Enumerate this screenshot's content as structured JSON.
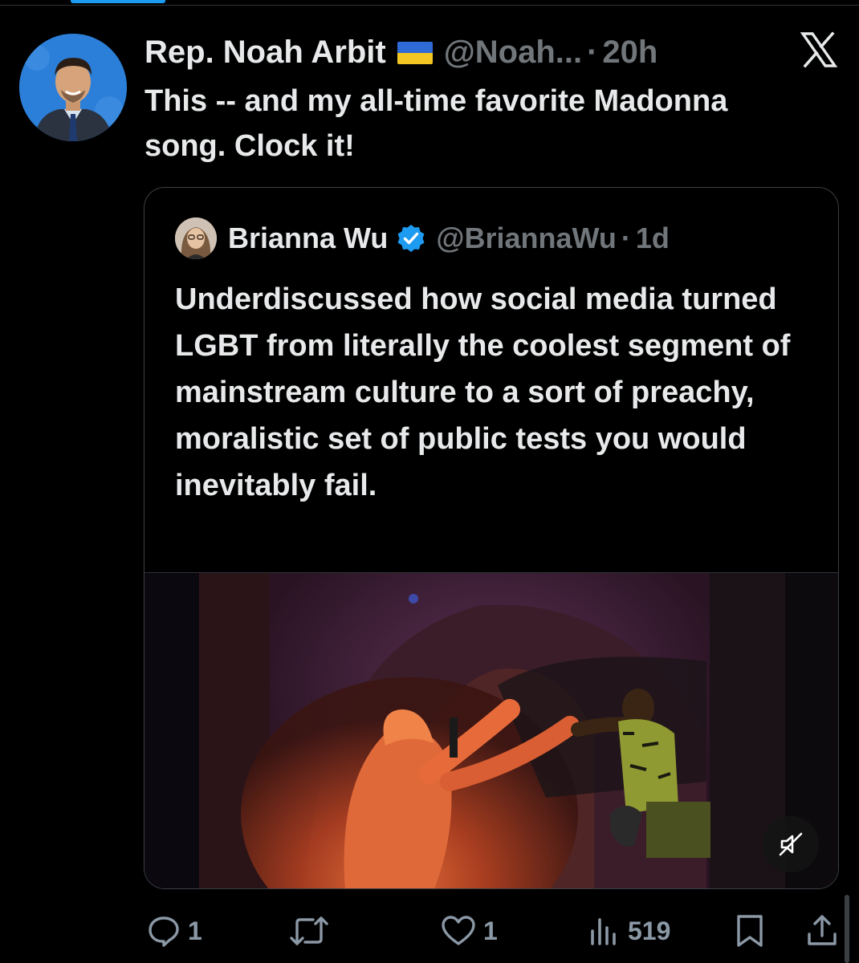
{
  "tweet": {
    "author_name": "Rep. Noah Arbit",
    "handle": "@Noah...",
    "separator": "·",
    "time": "20h",
    "text": "This -- and my all-time favorite Madonna song. Clock it!"
  },
  "quote": {
    "author_name": "Brianna Wu",
    "handle": "@BriannaWu",
    "separator": "·",
    "time": "1d",
    "text": "Underdiscussed how social media turned LGBT from literally the coolest segment of mainstream culture to a sort of preachy, moralistic set of public tests you would inevitably fail."
  },
  "actions": {
    "replies": "1",
    "likes": "1",
    "views": "519"
  },
  "icons": {
    "platform": "x-logo-icon",
    "verified": "verified-badge-icon",
    "flag": "ukraine-flag-icon",
    "mute": "mute-icon",
    "reply": "reply-icon",
    "repost": "repost-icon",
    "like": "heart-icon",
    "views": "views-icon",
    "bookmark": "bookmark-icon",
    "share": "share-icon"
  },
  "colors": {
    "background": "#000000",
    "text": "#e7e9ea",
    "muted": "#71767b",
    "accent": "#1d9bf0"
  }
}
